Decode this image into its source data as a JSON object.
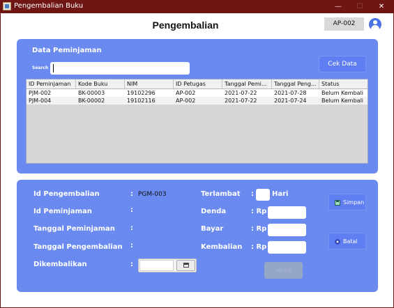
{
  "window": {
    "title": "Pengembalian Buku",
    "controls": {
      "minimize": "—",
      "maximize": "☐",
      "close": "✕"
    }
  },
  "header": {
    "page_title": "Pengembalian",
    "user_id": "AP-002",
    "avatar_icon": "user-circle-icon"
  },
  "peminjaman": {
    "section_title": "Data Peminjaman",
    "search_label": "Search",
    "search_value": "",
    "cek_data_label": "Cek Data",
    "columns": [
      "ID Peminjaman",
      "Kode Buku",
      "NIM",
      "ID Petugas",
      "Tanggal Pemi...",
      "Tanggal Peng...",
      "Status"
    ],
    "rows": [
      [
        "PJM-002",
        "BK-00003",
        "19102296",
        "AP-002",
        "2021-07-22",
        "2021-07-28",
        "Belum Kembali"
      ],
      [
        "PJM-004",
        "BK-00002",
        "19102116",
        "AP-002",
        "2021-07-22",
        "2021-07-24",
        "Belum Kembali"
      ]
    ]
  },
  "form": {
    "id_pengembalian_label": "Id Pengembalian",
    "id_pengembalian_value": "PGM-003",
    "id_peminjaman_label": "Id Peminjaman",
    "id_peminjaman_value": "",
    "tanggal_peminjaman_label": "Tanggal Peminjaman",
    "tanggal_peminjaman_value": "",
    "tanggal_pengembalian_label": "Tanggal Pengembalian",
    "tanggal_pengembalian_value": "",
    "dikembalikan_label": "Dikembalikan",
    "dikembalikan_value": "",
    "colon": ":",
    "terlambat_label": "Terlambat",
    "terlambat_colon": ":",
    "terlambat_value": "",
    "hari_label": "Hari",
    "denda_label": "Denda",
    "denda_value": "",
    "bayar_label": "Bayar",
    "bayar_value": "",
    "kembalian_label": "Kembalian",
    "kembalian_value": "",
    "rp_prefix": ": Rp",
    "hitung_label": "Hitung",
    "simpan_label": "Simpan",
    "batal_label": "Batal",
    "simpan_icon": "save-icon",
    "batal_icon": "cancel-circle-icon",
    "calendar_icon": "calendar-icon"
  },
  "colors": {
    "titlebar": "#6f1614",
    "panel": "#6a8af0",
    "button": "#5f7ef2",
    "avatar": "#4a72e6",
    "disabled_button": "#9aa8c2"
  }
}
